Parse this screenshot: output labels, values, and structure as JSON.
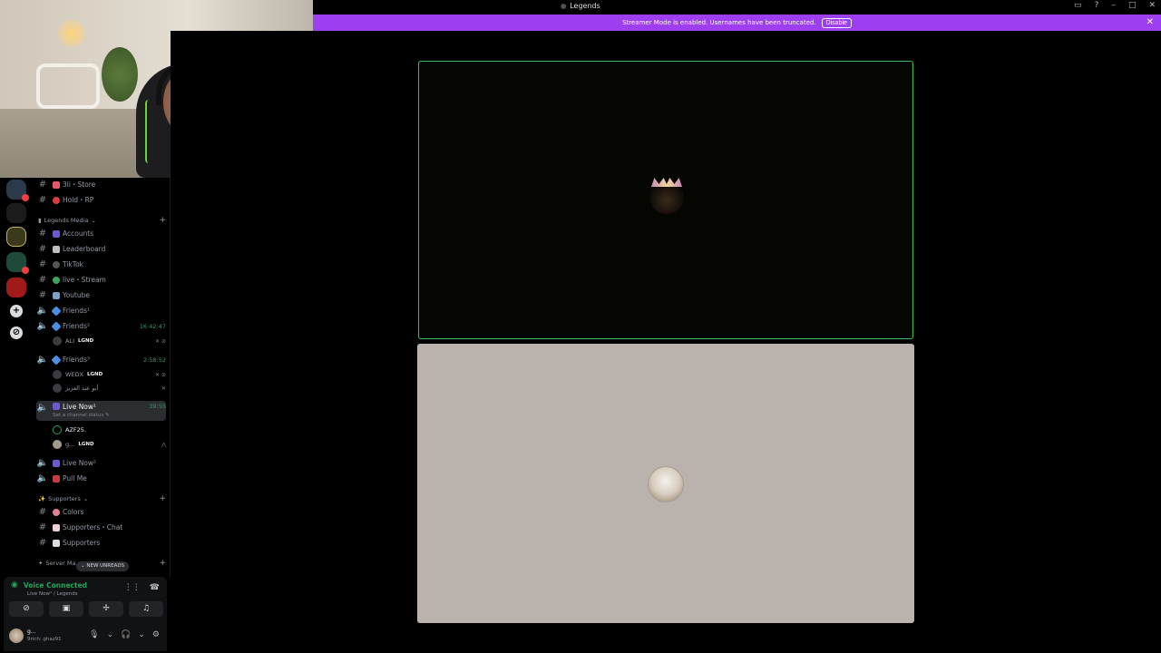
{
  "window": {
    "title": "Legends"
  },
  "banner": {
    "message": "Streamer Mode is enabled. Usernames have been truncated.",
    "disable_label": "Disable"
  },
  "channels": {
    "row1": "3li・Store",
    "row2": "Hold・RP",
    "cat_media": "Legends Media",
    "accounts": "Accounts",
    "leaderboard": "Leaderboard",
    "tiktok": "TikTok",
    "live_stream": "live・Stream",
    "youtube": "Youtube",
    "friends1": "Friends¹",
    "friends2": "Friends²",
    "friends2_timer": "16:42:47",
    "friends2_user": "ALI",
    "friends2_user_tag": "LGND",
    "friends3": "Friends³",
    "friends3_timer": "2:58:52",
    "friends3_user1": "WEDX",
    "friends3_user1_tag": "LGND",
    "friends3_user2": "أبو عبد العزيز",
    "live_now1": "Live Now¹",
    "live_now1_timer": "39:55",
    "live_now1_status": "Set a channel status",
    "live_now1_user1": "AZF25.",
    "live_now1_user2": "g...",
    "live_now1_user2_tag": "LGND",
    "live_now2": "Live Now²",
    "pull_me": "Pull Me",
    "cat_supporters": "Supporters",
    "colors": "Colors",
    "supporters_chat": "Supporters・Chat",
    "supporters": "Supporters",
    "cat_server": "Server Ma...",
    "new_unreads": "NEW UNREADS"
  },
  "voice": {
    "status": "Voice Connected",
    "channel": "Live Now¹ / Legends"
  },
  "user": {
    "name": "g...",
    "status": "9rich: ghaz91"
  },
  "colors": {
    "accent_banner": "#9d3ff0",
    "speaking_border": "#3fbf5c",
    "voice_green": "#23a55a"
  }
}
